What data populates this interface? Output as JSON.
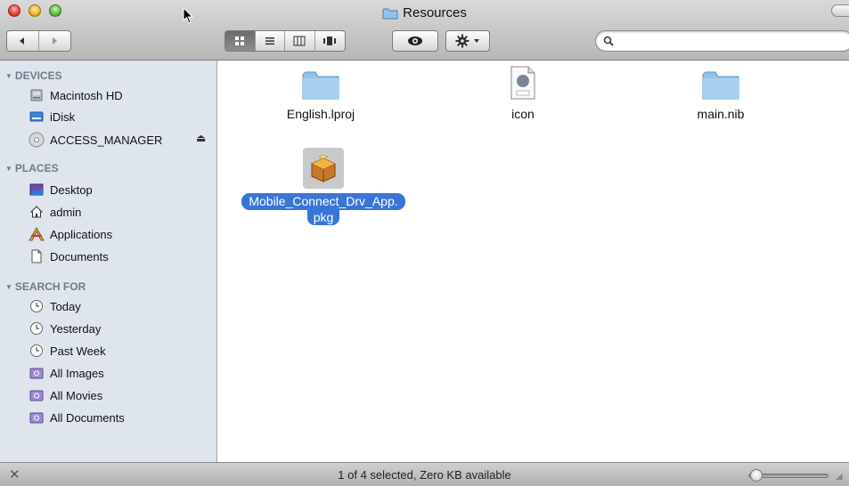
{
  "window": {
    "title": "Resources"
  },
  "toolbar": {
    "back_icon": "back-arrow-icon",
    "forward_icon": "forward-arrow-icon",
    "view_modes": [
      "icon-view",
      "list-view",
      "column-view",
      "cover-flow-view"
    ],
    "active_view": "icon-view",
    "quick_look_icon": "eye-icon",
    "action_icon": "gear-icon",
    "search_placeholder": "",
    "search_value": ""
  },
  "sidebar": {
    "devices": {
      "heading": "DEVICES",
      "items": [
        {
          "label": "Macintosh HD",
          "icon": "hard-drive-icon"
        },
        {
          "label": "iDisk",
          "icon": "idisk-icon"
        },
        {
          "label": "ACCESS_MANAGER",
          "icon": "cd-disc-icon",
          "ejectable": true
        }
      ]
    },
    "places": {
      "heading": "PLACES",
      "items": [
        {
          "label": "Desktop",
          "icon": "desktop-icon"
        },
        {
          "label": "admin",
          "icon": "home-icon"
        },
        {
          "label": "Applications",
          "icon": "applications-icon"
        },
        {
          "label": "Documents",
          "icon": "documents-icon"
        }
      ]
    },
    "search_for": {
      "heading": "SEARCH FOR",
      "items": [
        {
          "label": "Today",
          "icon": "clock-icon"
        },
        {
          "label": "Yesterday",
          "icon": "clock-icon"
        },
        {
          "label": "Past Week",
          "icon": "clock-icon"
        },
        {
          "label": "All Images",
          "icon": "smart-folder-icon"
        },
        {
          "label": "All Movies",
          "icon": "smart-folder-icon"
        },
        {
          "label": "All Documents",
          "icon": "smart-folder-icon"
        }
      ]
    }
  },
  "files": [
    {
      "name": "English.lproj",
      "type": "folder",
      "icon": "folder-icon",
      "selected": false
    },
    {
      "name": "icon",
      "type": "icns",
      "icon": "icns-file-icon",
      "selected": false
    },
    {
      "name": "main.nib",
      "type": "folder",
      "icon": "folder-icon",
      "selected": false
    },
    {
      "name_line1": "Mobile_Connect_Drv_App.",
      "name_line2": "pkg",
      "type": "package",
      "icon": "package-icon",
      "selected": true
    }
  ],
  "status_bar": {
    "text": "1 of 4 selected, Zero KB available"
  },
  "colors": {
    "selection": "#3875d7",
    "sidebar_bg": "#dfe5ed",
    "section_heading": "#6e7b8b",
    "folder_blue": "#8fc3ea"
  }
}
